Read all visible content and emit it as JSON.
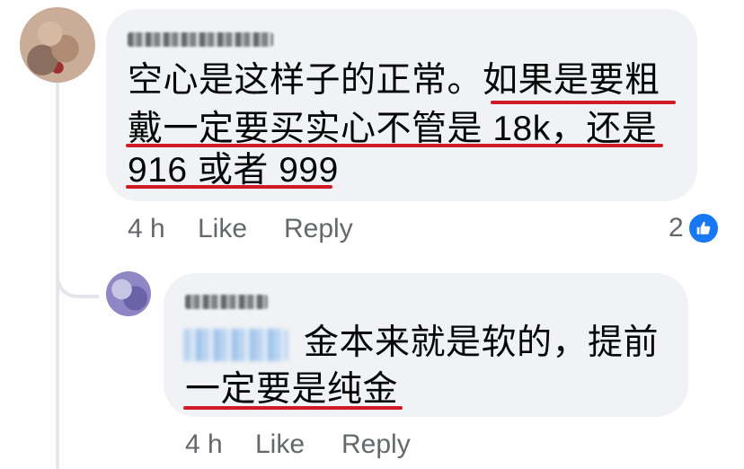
{
  "comments": [
    {
      "lines": [
        "空心是这样子的正常。如果是要粗",
        "戴一定要买实心不管是 18k，还是",
        "916 或者 999"
      ],
      "time": "4 h",
      "like_label": "Like",
      "reply_label": "Reply",
      "reaction_count": "2",
      "reaction_icon": "thumbs-up-icon"
    },
    {
      "lines": [
        "金本来就是软的，提前",
        "一定要是纯金"
      ],
      "time": "4 h",
      "like_label": "Like",
      "reply_label": "Reply"
    }
  ],
  "colors": {
    "bubble": "#f0f2f5",
    "meta_text": "#65676b",
    "underline": "#d01a24",
    "like_badge": "#1877f2"
  }
}
